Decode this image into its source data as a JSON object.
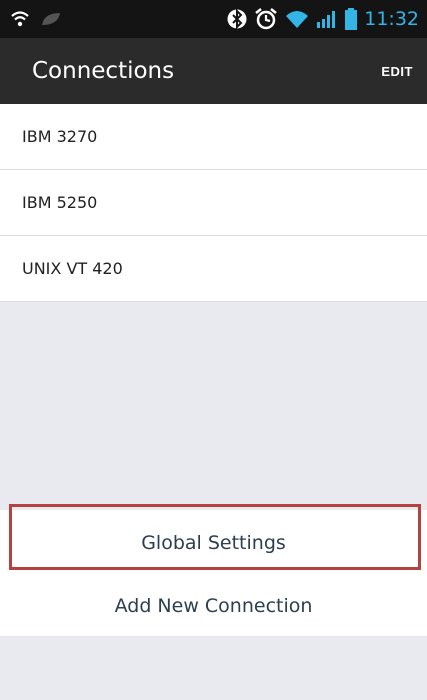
{
  "status_bar": {
    "time": "11:32",
    "icons": [
      "wifi-icon",
      "leaf-icon",
      "bluetooth-icon",
      "alarm-icon",
      "wifi-signal-icon",
      "cell-signal-icon",
      "battery-icon"
    ],
    "accent_color": "#33b5e5"
  },
  "app_bar": {
    "title": "Connections",
    "edit_label": "EDIT"
  },
  "connections": [
    {
      "label": "IBM 3270"
    },
    {
      "label": "IBM 5250"
    },
    {
      "label": "UNIX VT 420"
    }
  ],
  "actions": {
    "global_settings_label": "Global Settings",
    "add_connection_label": "Add New Connection"
  },
  "colors": {
    "highlight": "#b54141",
    "background": "#e9eaef",
    "toolbar": "#2b2b2b"
  }
}
